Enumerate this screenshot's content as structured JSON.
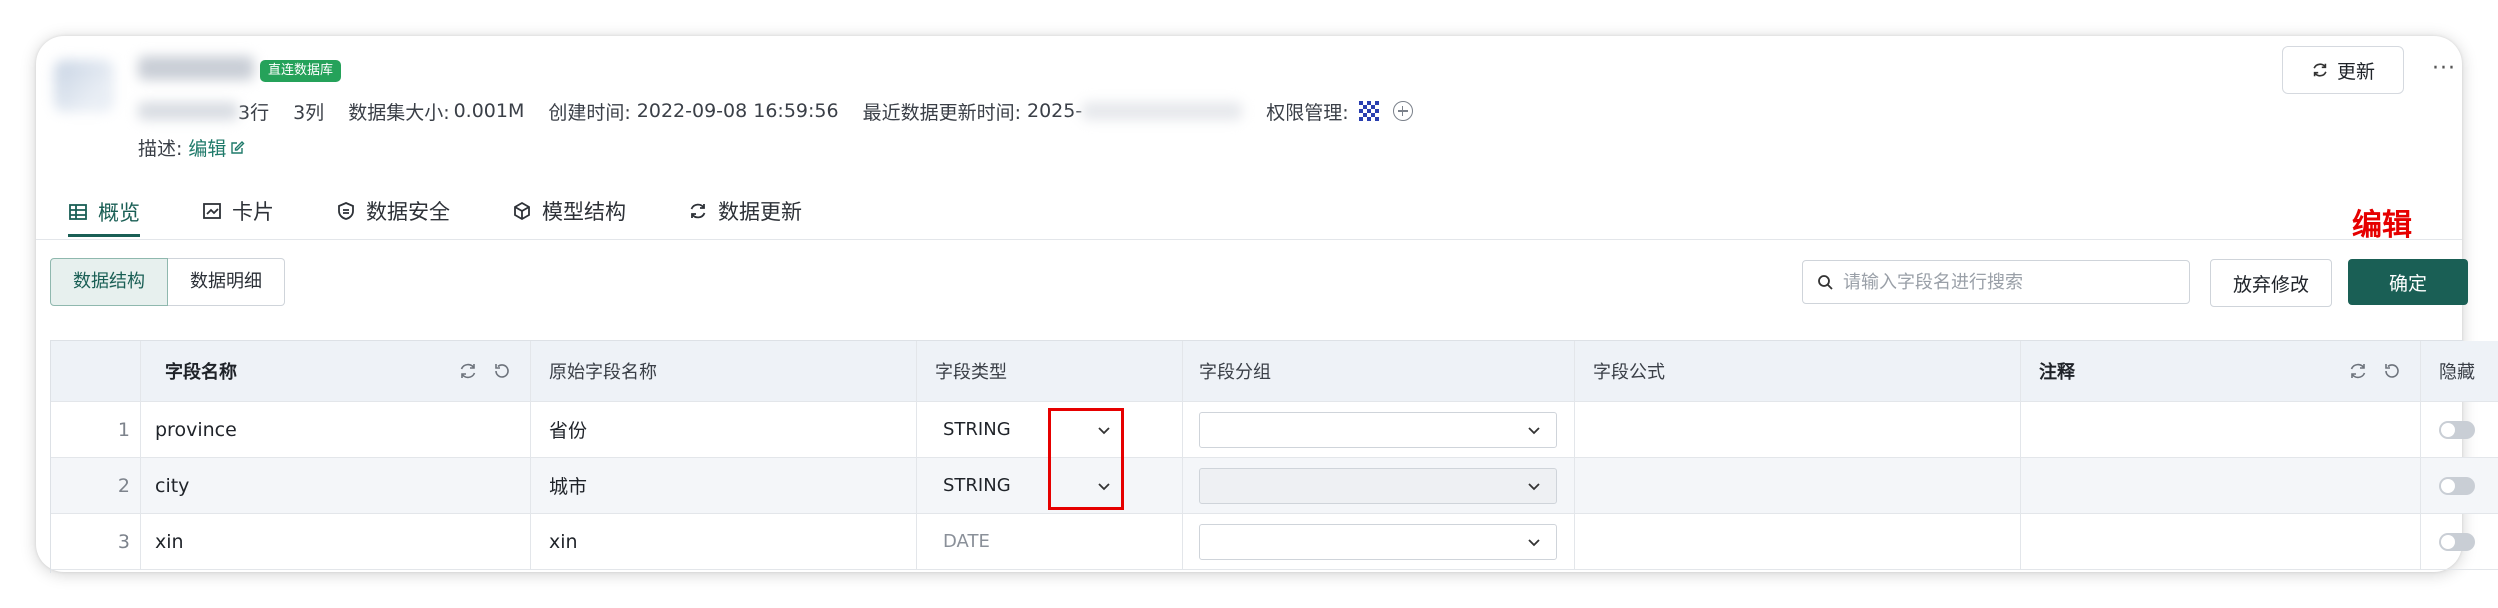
{
  "dataset": {
    "badge": "直连数据库",
    "rows": "3行",
    "cols": "3列",
    "size_label": "数据集大小:",
    "size_value": "0.001M",
    "created_label": "创建时间:",
    "created_value": "2022-09-08 16:59:56",
    "updated_label": "最近数据更新时间:",
    "updated_value": "2025-",
    "perm_label": "权限管理:",
    "desc_label": "描述:",
    "desc_link": "编辑"
  },
  "header": {
    "refresh_label": "更新",
    "more_label": "···"
  },
  "tabs": [
    {
      "label": "概览",
      "icon": "table-icon",
      "active": true
    },
    {
      "label": "卡片",
      "icon": "chart-icon"
    },
    {
      "label": "数据安全",
      "icon": "shield-icon"
    },
    {
      "label": "模型结构",
      "icon": "cube-icon"
    },
    {
      "label": "数据更新",
      "icon": "refresh-icon"
    }
  ],
  "annotation": "编辑",
  "view_toggle": {
    "options": [
      "数据结构",
      "数据明细"
    ],
    "selected": "数据结构"
  },
  "search": {
    "placeholder": "请输入字段名进行搜索",
    "value": ""
  },
  "actions": {
    "discard": "放弃修改",
    "confirm": "确定"
  },
  "table": {
    "columns": [
      "",
      "字段名称",
      "原始字段名称",
      "字段类型",
      "字段分组",
      "字段公式",
      "注释",
      "隐藏"
    ],
    "rows": [
      {
        "index": "1",
        "name": "province",
        "original": "省份",
        "type": "STRING",
        "group": "",
        "formula": "",
        "note": ""
      },
      {
        "index": "2",
        "name": "city",
        "original": "城市",
        "type": "STRING",
        "group": "",
        "formula": "",
        "note": ""
      },
      {
        "index": "3",
        "name": "xin",
        "original": "xin",
        "type": "DATE",
        "group": "",
        "formula": "",
        "note": ""
      }
    ]
  },
  "colors": {
    "accent": "#1a5f55",
    "badge": "#25a25a",
    "annotation": "#e60000"
  }
}
